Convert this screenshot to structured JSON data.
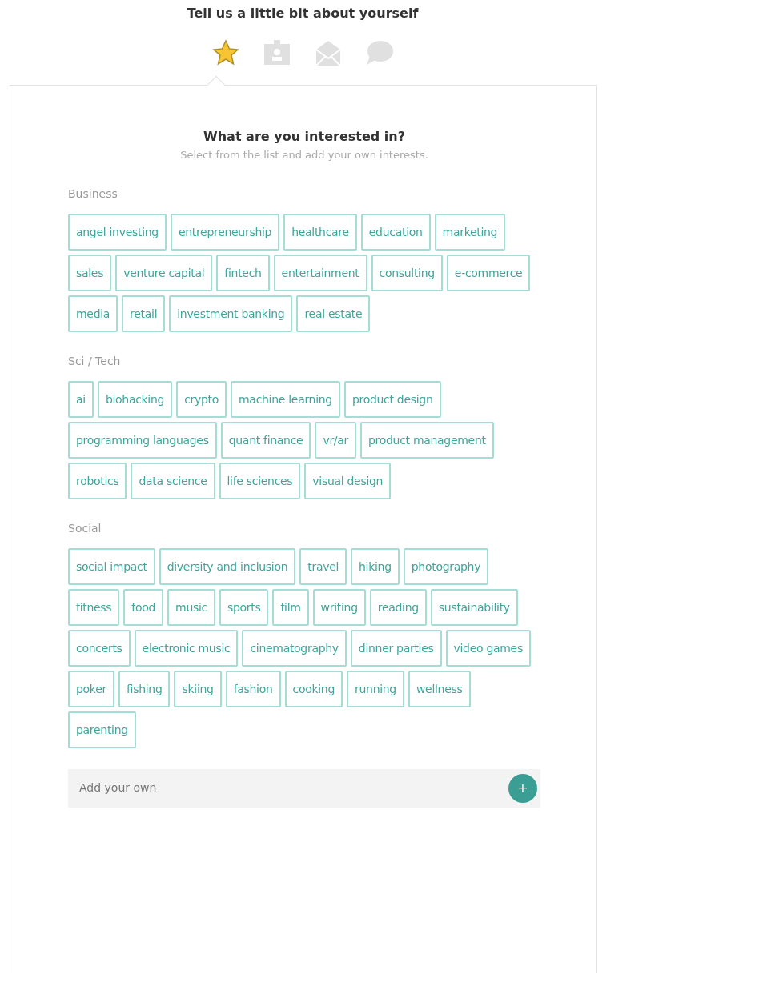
{
  "heading": "Tell us a little bit about yourself",
  "steps": [
    {
      "kind": "star",
      "selected": true
    },
    {
      "kind": "badge",
      "selected": false
    },
    {
      "kind": "mail",
      "selected": false
    },
    {
      "kind": "chat",
      "selected": false
    }
  ],
  "card": {
    "title": "What are you interested in?",
    "subtitle": "Select from the list and add your own interests.",
    "sections": [
      {
        "label": "Business",
        "tags": [
          {
            "label": "angel investing",
            "selected": false
          },
          {
            "label": "entrepreneurship",
            "selected": false
          },
          {
            "label": "healthcare",
            "selected": false
          },
          {
            "label": "education",
            "selected": false
          },
          {
            "label": "marketing",
            "selected": false
          },
          {
            "label": "sales",
            "selected": false
          },
          {
            "label": "venture capital",
            "selected": false
          },
          {
            "label": "fintech",
            "selected": false
          },
          {
            "label": "entertainment",
            "selected": false
          },
          {
            "label": "consulting",
            "selected": false
          },
          {
            "label": "e-commerce",
            "selected": false
          },
          {
            "label": "media",
            "selected": false
          },
          {
            "label": "retail",
            "selected": false
          },
          {
            "label": "investment banking",
            "selected": false
          },
          {
            "label": "real estate",
            "selected": false
          }
        ]
      },
      {
        "label": "Sci / Tech",
        "tags": [
          {
            "label": "ai",
            "selected": false
          },
          {
            "label": "biohacking",
            "selected": false
          },
          {
            "label": "crypto",
            "selected": false
          },
          {
            "label": "machine learning",
            "selected": false
          },
          {
            "label": "product design",
            "selected": false
          },
          {
            "label": "programming languages",
            "selected": false
          },
          {
            "label": "quant finance",
            "selected": false
          },
          {
            "label": "vr/ar",
            "selected": false
          },
          {
            "label": "product management",
            "selected": false
          },
          {
            "label": "robotics",
            "selected": false
          },
          {
            "label": "data science",
            "selected": false
          },
          {
            "label": "life sciences",
            "selected": false
          },
          {
            "label": "visual design",
            "selected": false
          }
        ]
      },
      {
        "label": "Social",
        "tags": [
          {
            "label": "social impact",
            "selected": false
          },
          {
            "label": "diversity and inclusion",
            "selected": false
          },
          {
            "label": "travel",
            "selected": false
          },
          {
            "label": "hiking",
            "selected": false
          },
          {
            "label": "photography",
            "selected": false
          },
          {
            "label": "fitness",
            "selected": false
          },
          {
            "label": "food",
            "selected": false
          },
          {
            "label": "music",
            "selected": false
          },
          {
            "label": "sports",
            "selected": false
          },
          {
            "label": "film",
            "selected": false
          },
          {
            "label": "writing",
            "selected": false
          },
          {
            "label": "reading",
            "selected": false
          },
          {
            "label": "sustainability",
            "selected": false
          },
          {
            "label": "concerts",
            "selected": false
          },
          {
            "label": "electronic music",
            "selected": false
          },
          {
            "label": "cinematography",
            "selected": false
          },
          {
            "label": "dinner parties",
            "selected": false
          },
          {
            "label": "video games",
            "selected": false
          },
          {
            "label": "poker",
            "selected": false
          },
          {
            "label": "fishing",
            "selected": false
          },
          {
            "label": "skiing",
            "selected": false
          },
          {
            "label": "fashion",
            "selected": false
          },
          {
            "label": "cooking",
            "selected": false
          },
          {
            "label": "running",
            "selected": false
          },
          {
            "label": "wellness",
            "selected": false
          },
          {
            "label": "parenting",
            "selected": false
          }
        ]
      }
    ],
    "add_field": {
      "placeholder": "Add your own",
      "button": "+"
    }
  }
}
